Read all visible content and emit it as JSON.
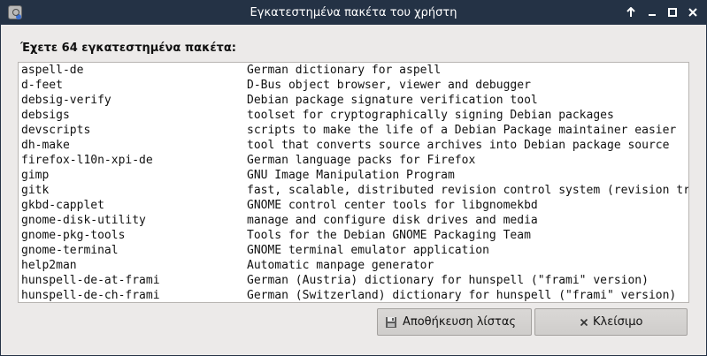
{
  "window": {
    "title": "Εγκατεστημένα πακέτα του χρήστη",
    "buttons": {
      "keep_above": "↑",
      "minimize": "–",
      "maximize": "□",
      "close": "✕"
    }
  },
  "heading": "Έχετε 64 εγκατεστημένα πακέτα:",
  "packages": [
    {
      "name": "aspell-de",
      "description": "German dictionary for aspell"
    },
    {
      "name": "d-feet",
      "description": "D-Bus object browser, viewer and debugger"
    },
    {
      "name": "debsig-verify",
      "description": "Debian package signature verification tool"
    },
    {
      "name": "debsigs",
      "description": "toolset for cryptographically signing Debian packages"
    },
    {
      "name": "devscripts",
      "description": "scripts to make the life of a Debian Package maintainer easier"
    },
    {
      "name": "dh-make",
      "description": "tool that converts source archives into Debian package source"
    },
    {
      "name": "firefox-l10n-xpi-de",
      "description": "German language packs for Firefox"
    },
    {
      "name": "gimp",
      "description": "GNU Image Manipulation Program"
    },
    {
      "name": "gitk",
      "description": "fast, scalable, distributed revision control system (revision tree visualizer)"
    },
    {
      "name": "gkbd-capplet",
      "description": "GNOME control center tools for libgnomekbd"
    },
    {
      "name": "gnome-disk-utility",
      "description": "manage and configure disk drives and media"
    },
    {
      "name": "gnome-pkg-tools",
      "description": "Tools for the Debian GNOME Packaging Team"
    },
    {
      "name": "gnome-terminal",
      "description": "GNOME terminal emulator application"
    },
    {
      "name": "help2man",
      "description": "Automatic manpage generator"
    },
    {
      "name": "hunspell-de-at-frami",
      "description": "German (Austria) dictionary for hunspell (\"frami\" version)"
    },
    {
      "name": "hunspell-de-ch-frami",
      "description": "German (Switzerland) dictionary for hunspell (\"frami\" version)"
    }
  ],
  "actions": {
    "save_label": "Αποθήκευση λίστας",
    "close_label": "Κλείσιμο"
  },
  "icons": {
    "app": "app-icon",
    "save": "floppy-disk-icon",
    "close": "close-x-icon"
  },
  "colors": {
    "titlebar": "#243245",
    "background": "#eceae9",
    "list_background": "#ffffff"
  }
}
